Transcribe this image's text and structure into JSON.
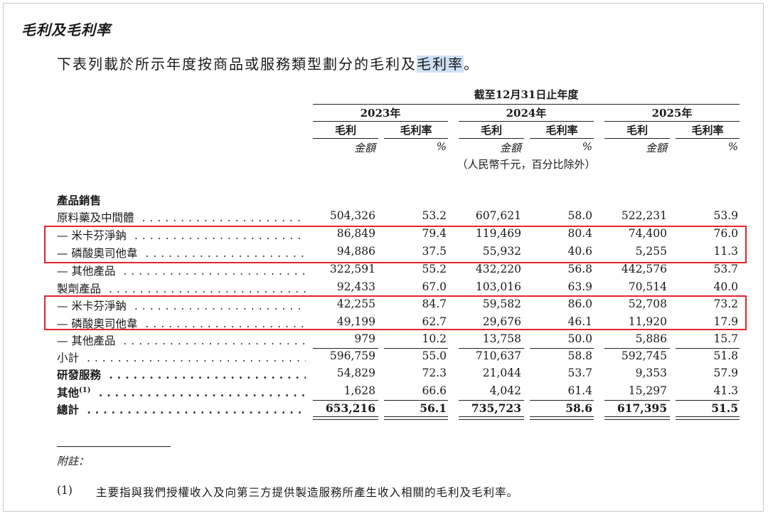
{
  "section_title": "毛利及毛利率",
  "intro": {
    "before": "下表列載於所示年度按商品或服務類型劃分的毛利及",
    "highlight": "毛利率",
    "after": "。"
  },
  "table": {
    "period_header": "截至12月31日止年度",
    "years": [
      "2023年",
      "2024年",
      "2025年"
    ],
    "col_gp": "毛利",
    "col_margin": "毛利率",
    "unit_amount": "金額",
    "unit_pct": "%",
    "unit_note": "（人民幣千元，百分比除外）",
    "category_label": "產品銷售",
    "rows": [
      {
        "label": "原料藥及中間體",
        "bold": false,
        "values": [
          "504,326",
          "53.2",
          "607,621",
          "58.0",
          "522,231",
          "53.9"
        ]
      },
      {
        "label": "— 米卡芬淨鈉",
        "bold": false,
        "values": [
          "86,849",
          "79.4",
          "119,469",
          "80.4",
          "74,400",
          "76.0"
        ]
      },
      {
        "label": "— 磷酸奧司他韋",
        "bold": false,
        "values": [
          "94,886",
          "37.5",
          "55,932",
          "40.6",
          "5,255",
          "11.3"
        ]
      },
      {
        "label": "— 其他產品",
        "bold": false,
        "values": [
          "322,591",
          "55.2",
          "432,220",
          "56.8",
          "442,576",
          "53.7"
        ]
      },
      {
        "label": "製劑產品",
        "bold": false,
        "values": [
          "92,433",
          "67.0",
          "103,016",
          "63.9",
          "70,514",
          "40.0"
        ]
      },
      {
        "label": "— 米卡芬淨鈉",
        "bold": false,
        "values": [
          "42,255",
          "84.7",
          "59,582",
          "86.0",
          "52,708",
          "73.2"
        ]
      },
      {
        "label": "— 磷酸奧司他韋",
        "bold": false,
        "values": [
          "49,199",
          "62.7",
          "29,676",
          "46.1",
          "11,920",
          "17.9"
        ]
      },
      {
        "label": "— 其他產品",
        "bold": false,
        "values": [
          "979",
          "10.2",
          "13,758",
          "50.0",
          "5,886",
          "15.7"
        ]
      },
      {
        "label": "小計",
        "bold": false,
        "values": [
          "596,759",
          "55.0",
          "710,637",
          "58.8",
          "592,745",
          "51.8"
        ]
      },
      {
        "label": "研發服務",
        "bold": true,
        "values": [
          "54,829",
          "72.3",
          "21,044",
          "53.7",
          "9,353",
          "57.9"
        ]
      },
      {
        "label": "其他",
        "sup": "(1)",
        "bold": true,
        "values": [
          "1,628",
          "66.6",
          "4,042",
          "61.4",
          "15,297",
          "41.3"
        ]
      },
      {
        "label": "總計",
        "bold": true,
        "total": true,
        "values": [
          "653,216",
          "56.1",
          "735,723",
          "58.6",
          "617,395",
          "51.5"
        ]
      }
    ]
  },
  "footnote": {
    "heading": "附註：",
    "number": "(1)",
    "text": "主要指與我們授權收入及向第三方提供製造服務所產生收入相關的毛利及毛利率。"
  },
  "colors": {
    "highlight_box": "#e2262b",
    "text_highlight": "#cfe0f5"
  }
}
